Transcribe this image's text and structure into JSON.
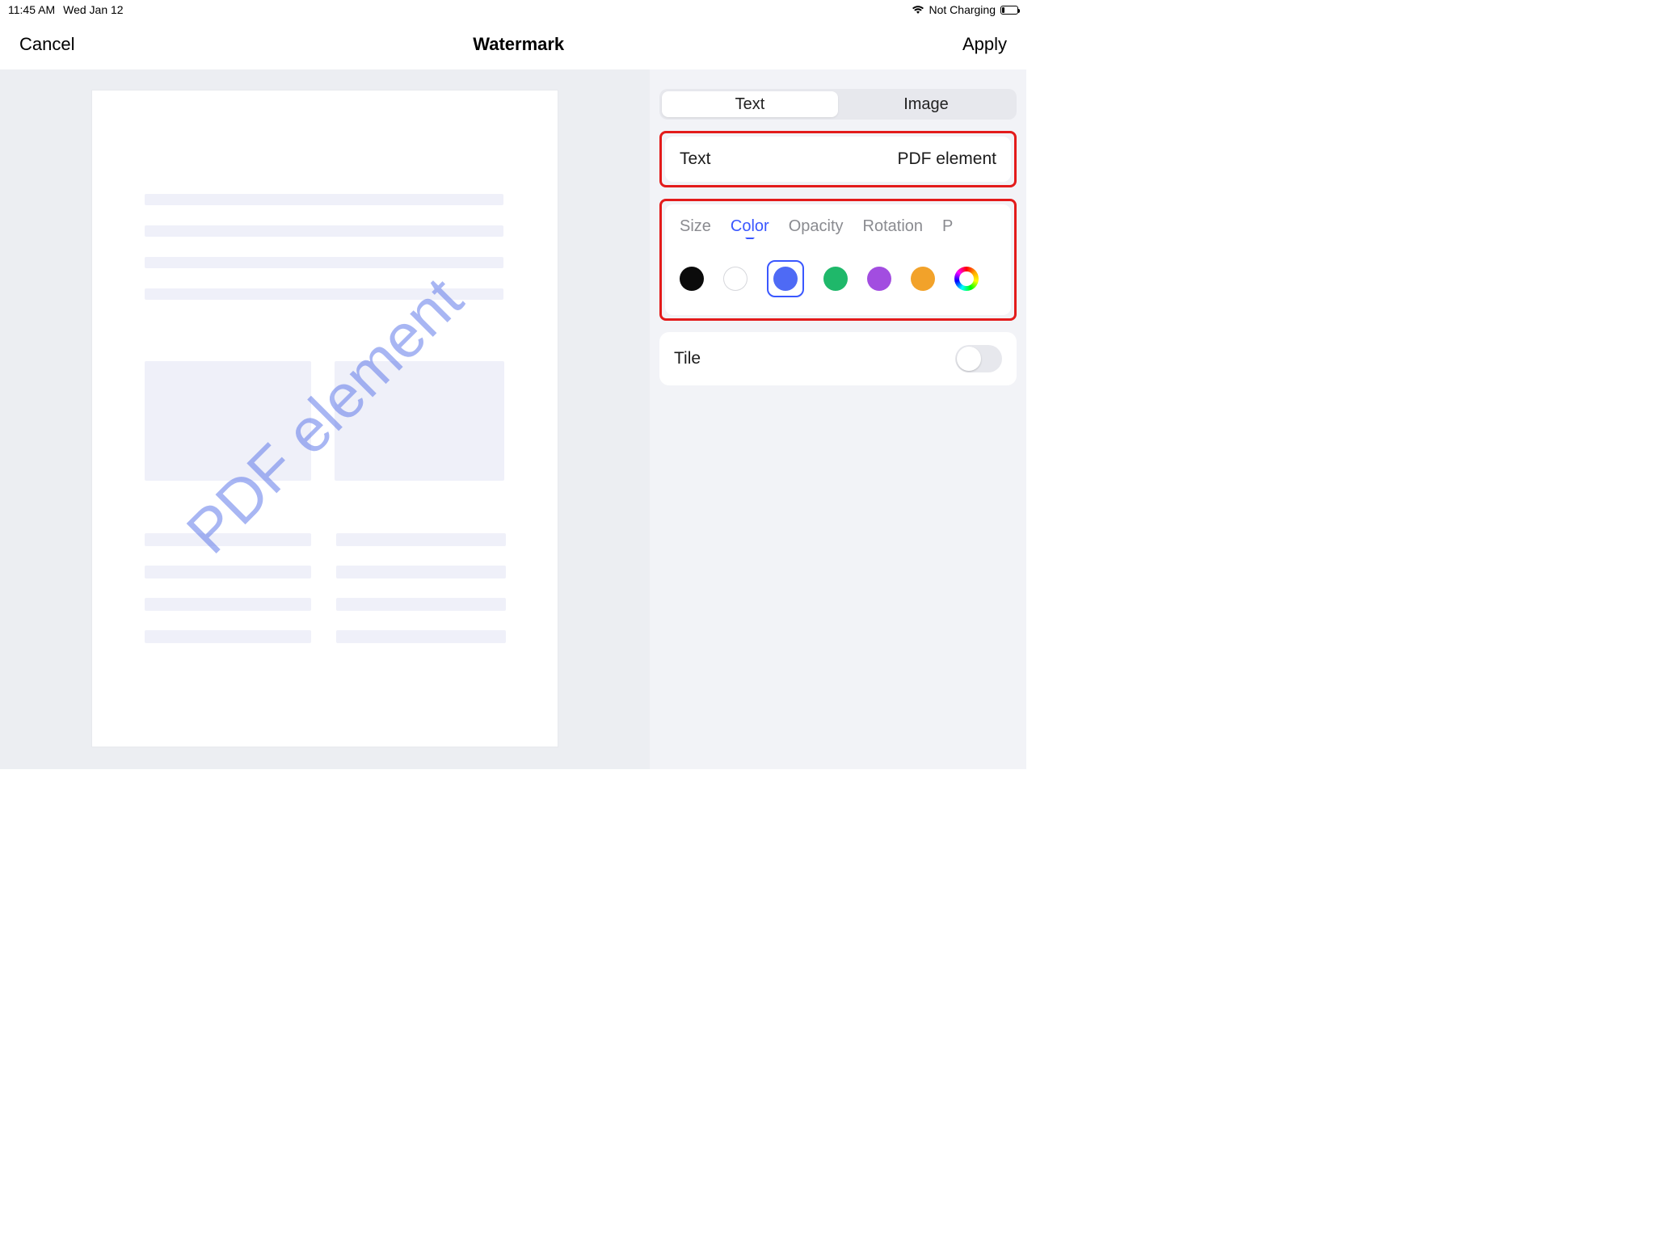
{
  "status": {
    "time": "11:45 AM",
    "date": "Wed Jan 12",
    "battery_text": "Not Charging"
  },
  "nav": {
    "cancel": "Cancel",
    "title": "Watermark",
    "apply": "Apply"
  },
  "segmented": {
    "text": "Text",
    "image": "Image"
  },
  "text_row": {
    "label": "Text",
    "value": "PDF element"
  },
  "props": {
    "size": "Size",
    "color": "Color",
    "opacity": "Opacity",
    "rotation": "Rotation",
    "position_partial": "P"
  },
  "colors": {
    "black": "#0b0b0b",
    "white": "#ffffff",
    "blue": "#4e6af5",
    "green": "#1fb86a",
    "purple": "#a24de0",
    "orange": "#f2a22a"
  },
  "tile": {
    "label": "Tile"
  },
  "watermark_text": "PDF element"
}
